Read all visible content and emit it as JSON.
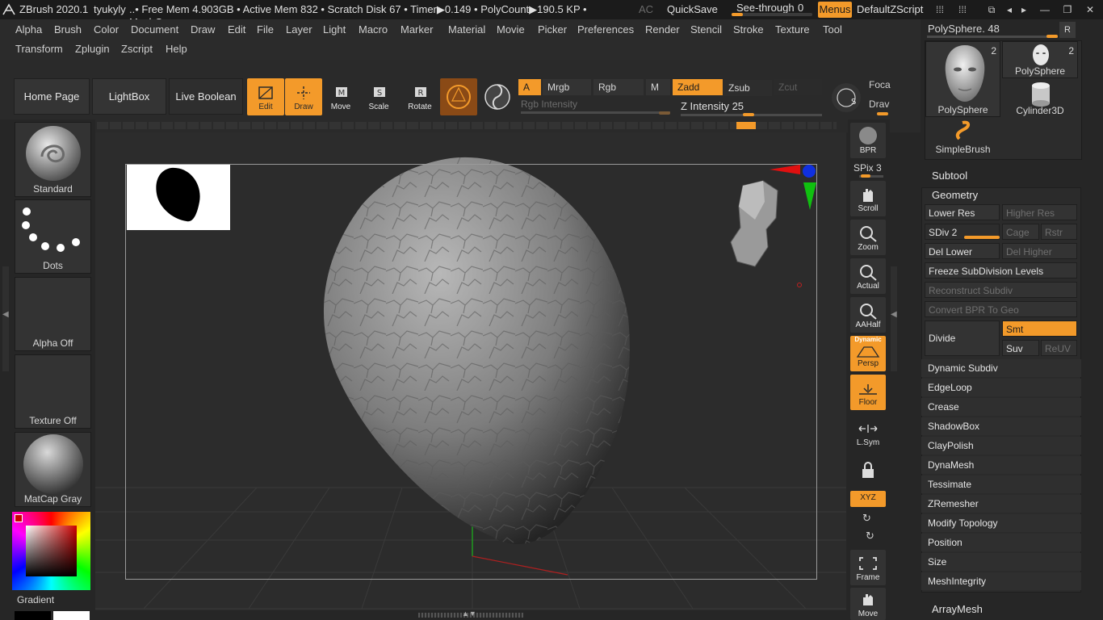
{
  "titlebar": {
    "app": "ZBrush 2020.1",
    "doc": "tyukyly",
    "stats": "..• Free Mem 4.903GB • Active Mem 832 • Scratch Disk 67 • Timer▶0.149 • PolyCount▶190.5 KP • MeshCour",
    "ac": "AC",
    "quicksave": "QuickSave",
    "seethrough_label": "See-through",
    "seethrough_value": "0",
    "seethrough_fraction": 0,
    "menus": "Menus",
    "script": "DefaultZScript"
  },
  "menubar": {
    "row1": [
      "Alpha",
      "Brush",
      "Color",
      "Document",
      "Draw",
      "Edit",
      "File",
      "Layer",
      "Light",
      "Macro",
      "Marker",
      "Material",
      "Movie",
      "Picker",
      "Preferences",
      "Render",
      "Stencil",
      "Stroke",
      "Texture",
      "Tool"
    ],
    "row2": [
      "Transform",
      "Zplugin",
      "Zscript",
      "Help"
    ]
  },
  "shelf": {
    "home_page": "Home Page",
    "lightbox": "LightBox",
    "live_boolean": "Live Boolean",
    "edit": "Edit",
    "draw": "Draw",
    "move": "Move",
    "scale": "Scale",
    "rotate": "Rotate",
    "a_chip": "A",
    "mrgb": "Mrgb",
    "rgb": "Rgb",
    "m": "M",
    "zadd": "Zadd",
    "zsub": "Zsub",
    "zcut": "Zcut",
    "rgb_intensity": "Rgb Intensity",
    "z_intensity": "Z Intensity 25",
    "focal": "Foca",
    "draw_size": "Drav"
  },
  "leftpanel": {
    "brush": "Standard",
    "stroke": "Dots",
    "alpha": "Alpha Off",
    "texture": "Texture Off",
    "material": "MatCap Gray",
    "gradient": "Gradient"
  },
  "rtoolbar": {
    "bpr": "BPR",
    "spix": "SPix 3",
    "scroll": "Scroll",
    "zoom": "Zoom",
    "actual": "Actual",
    "aahalf": "AAHalf",
    "dynamic": "Dynamic",
    "persp": "Persp",
    "floor": "Floor",
    "lsym": "L.Sym",
    "xyz": "XYZ",
    "frame": "Frame",
    "move": "Move"
  },
  "rightpanel": {
    "current_tool": "PolySphere. 48",
    "r_btn": "R",
    "tools": [
      {
        "name": "PolySphere",
        "count": "2"
      },
      {
        "name": "PolySphere",
        "count": "2"
      },
      {
        "name": "Cylinder3D",
        "count": ""
      },
      {
        "name": "SimpleBrush",
        "count": ""
      }
    ],
    "subtool": "Subtool",
    "geometry": "Geometry",
    "lower_res": "Lower Res",
    "higher_res": "Higher Res",
    "sdiv": "SDiv 2",
    "cage": "Cage",
    "rstr": "Rstr",
    "del_lower": "Del Lower",
    "del_higher": "Del Higher",
    "freeze": "Freeze SubDivision Levels",
    "reconstruct": "Reconstruct Subdiv",
    "convert_bpr": "Convert BPR To Geo",
    "divide": "Divide",
    "smt": "Smt",
    "suv": "Suv",
    "reuv": "ReUV",
    "sections": [
      "Dynamic Subdiv",
      "EdgeLoop",
      "Crease",
      "ShadowBox",
      "ClayPolish",
      "DynaMesh",
      "Tessimate",
      "ZRemesher",
      "Modify Topology",
      "Position",
      "Size",
      "MeshIntegrity"
    ],
    "arraymesh": "ArrayMesh"
  },
  "colors": {
    "accent": "#f39a2a",
    "bg": "#262626",
    "panel": "#333333"
  }
}
